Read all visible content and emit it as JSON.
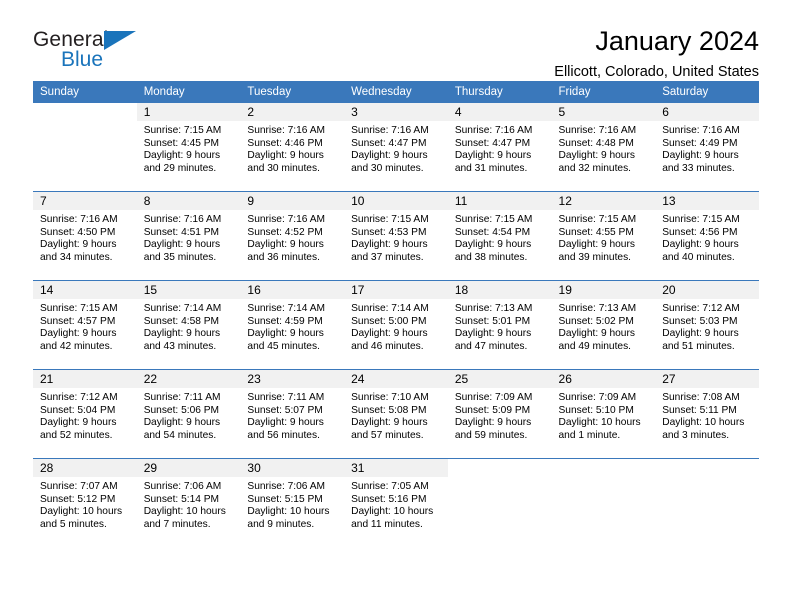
{
  "brand": {
    "name_part1": "General",
    "name_part2": "Blue",
    "triangle_icon": "triangle-icon",
    "accent_color": "#1a74bb"
  },
  "header": {
    "title": "January 2024",
    "subtitle": "Ellicott, Colorado, United States"
  },
  "calendar": {
    "header_bg": "#3a78bb",
    "daynum_bg": "#f1f1f1",
    "weekday_headers": [
      "Sunday",
      "Monday",
      "Tuesday",
      "Wednesday",
      "Thursday",
      "Friday",
      "Saturday"
    ],
    "weeks": [
      [
        {
          "day": "",
          "sunrise": "",
          "sunset": "",
          "daylight_line1": "",
          "daylight_line2": ""
        },
        {
          "day": "1",
          "sunrise": "Sunrise: 7:15 AM",
          "sunset": "Sunset: 4:45 PM",
          "daylight_line1": "Daylight: 9 hours",
          "daylight_line2": "and 29 minutes."
        },
        {
          "day": "2",
          "sunrise": "Sunrise: 7:16 AM",
          "sunset": "Sunset: 4:46 PM",
          "daylight_line1": "Daylight: 9 hours",
          "daylight_line2": "and 30 minutes."
        },
        {
          "day": "3",
          "sunrise": "Sunrise: 7:16 AM",
          "sunset": "Sunset: 4:47 PM",
          "daylight_line1": "Daylight: 9 hours",
          "daylight_line2": "and 30 minutes."
        },
        {
          "day": "4",
          "sunrise": "Sunrise: 7:16 AM",
          "sunset": "Sunset: 4:47 PM",
          "daylight_line1": "Daylight: 9 hours",
          "daylight_line2": "and 31 minutes."
        },
        {
          "day": "5",
          "sunrise": "Sunrise: 7:16 AM",
          "sunset": "Sunset: 4:48 PM",
          "daylight_line1": "Daylight: 9 hours",
          "daylight_line2": "and 32 minutes."
        },
        {
          "day": "6",
          "sunrise": "Sunrise: 7:16 AM",
          "sunset": "Sunset: 4:49 PM",
          "daylight_line1": "Daylight: 9 hours",
          "daylight_line2": "and 33 minutes."
        }
      ],
      [
        {
          "day": "7",
          "sunrise": "Sunrise: 7:16 AM",
          "sunset": "Sunset: 4:50 PM",
          "daylight_line1": "Daylight: 9 hours",
          "daylight_line2": "and 34 minutes."
        },
        {
          "day": "8",
          "sunrise": "Sunrise: 7:16 AM",
          "sunset": "Sunset: 4:51 PM",
          "daylight_line1": "Daylight: 9 hours",
          "daylight_line2": "and 35 minutes."
        },
        {
          "day": "9",
          "sunrise": "Sunrise: 7:16 AM",
          "sunset": "Sunset: 4:52 PM",
          "daylight_line1": "Daylight: 9 hours",
          "daylight_line2": "and 36 minutes."
        },
        {
          "day": "10",
          "sunrise": "Sunrise: 7:15 AM",
          "sunset": "Sunset: 4:53 PM",
          "daylight_line1": "Daylight: 9 hours",
          "daylight_line2": "and 37 minutes."
        },
        {
          "day": "11",
          "sunrise": "Sunrise: 7:15 AM",
          "sunset": "Sunset: 4:54 PM",
          "daylight_line1": "Daylight: 9 hours",
          "daylight_line2": "and 38 minutes."
        },
        {
          "day": "12",
          "sunrise": "Sunrise: 7:15 AM",
          "sunset": "Sunset: 4:55 PM",
          "daylight_line1": "Daylight: 9 hours",
          "daylight_line2": "and 39 minutes."
        },
        {
          "day": "13",
          "sunrise": "Sunrise: 7:15 AM",
          "sunset": "Sunset: 4:56 PM",
          "daylight_line1": "Daylight: 9 hours",
          "daylight_line2": "and 40 minutes."
        }
      ],
      [
        {
          "day": "14",
          "sunrise": "Sunrise: 7:15 AM",
          "sunset": "Sunset: 4:57 PM",
          "daylight_line1": "Daylight: 9 hours",
          "daylight_line2": "and 42 minutes."
        },
        {
          "day": "15",
          "sunrise": "Sunrise: 7:14 AM",
          "sunset": "Sunset: 4:58 PM",
          "daylight_line1": "Daylight: 9 hours",
          "daylight_line2": "and 43 minutes."
        },
        {
          "day": "16",
          "sunrise": "Sunrise: 7:14 AM",
          "sunset": "Sunset: 4:59 PM",
          "daylight_line1": "Daylight: 9 hours",
          "daylight_line2": "and 45 minutes."
        },
        {
          "day": "17",
          "sunrise": "Sunrise: 7:14 AM",
          "sunset": "Sunset: 5:00 PM",
          "daylight_line1": "Daylight: 9 hours",
          "daylight_line2": "and 46 minutes."
        },
        {
          "day": "18",
          "sunrise": "Sunrise: 7:13 AM",
          "sunset": "Sunset: 5:01 PM",
          "daylight_line1": "Daylight: 9 hours",
          "daylight_line2": "and 47 minutes."
        },
        {
          "day": "19",
          "sunrise": "Sunrise: 7:13 AM",
          "sunset": "Sunset: 5:02 PM",
          "daylight_line1": "Daylight: 9 hours",
          "daylight_line2": "and 49 minutes."
        },
        {
          "day": "20",
          "sunrise": "Sunrise: 7:12 AM",
          "sunset": "Sunset: 5:03 PM",
          "daylight_line1": "Daylight: 9 hours",
          "daylight_line2": "and 51 minutes."
        }
      ],
      [
        {
          "day": "21",
          "sunrise": "Sunrise: 7:12 AM",
          "sunset": "Sunset: 5:04 PM",
          "daylight_line1": "Daylight: 9 hours",
          "daylight_line2": "and 52 minutes."
        },
        {
          "day": "22",
          "sunrise": "Sunrise: 7:11 AM",
          "sunset": "Sunset: 5:06 PM",
          "daylight_line1": "Daylight: 9 hours",
          "daylight_line2": "and 54 minutes."
        },
        {
          "day": "23",
          "sunrise": "Sunrise: 7:11 AM",
          "sunset": "Sunset: 5:07 PM",
          "daylight_line1": "Daylight: 9 hours",
          "daylight_line2": "and 56 minutes."
        },
        {
          "day": "24",
          "sunrise": "Sunrise: 7:10 AM",
          "sunset": "Sunset: 5:08 PM",
          "daylight_line1": "Daylight: 9 hours",
          "daylight_line2": "and 57 minutes."
        },
        {
          "day": "25",
          "sunrise": "Sunrise: 7:09 AM",
          "sunset": "Sunset: 5:09 PM",
          "daylight_line1": "Daylight: 9 hours",
          "daylight_line2": "and 59 minutes."
        },
        {
          "day": "26",
          "sunrise": "Sunrise: 7:09 AM",
          "sunset": "Sunset: 5:10 PM",
          "daylight_line1": "Daylight: 10 hours",
          "daylight_line2": "and 1 minute."
        },
        {
          "day": "27",
          "sunrise": "Sunrise: 7:08 AM",
          "sunset": "Sunset: 5:11 PM",
          "daylight_line1": "Daylight: 10 hours",
          "daylight_line2": "and 3 minutes."
        }
      ],
      [
        {
          "day": "28",
          "sunrise": "Sunrise: 7:07 AM",
          "sunset": "Sunset: 5:12 PM",
          "daylight_line1": "Daylight: 10 hours",
          "daylight_line2": "and 5 minutes."
        },
        {
          "day": "29",
          "sunrise": "Sunrise: 7:06 AM",
          "sunset": "Sunset: 5:14 PM",
          "daylight_line1": "Daylight: 10 hours",
          "daylight_line2": "and 7 minutes."
        },
        {
          "day": "30",
          "sunrise": "Sunrise: 7:06 AM",
          "sunset": "Sunset: 5:15 PM",
          "daylight_line1": "Daylight: 10 hours",
          "daylight_line2": "and 9 minutes."
        },
        {
          "day": "31",
          "sunrise": "Sunrise: 7:05 AM",
          "sunset": "Sunset: 5:16 PM",
          "daylight_line1": "Daylight: 10 hours",
          "daylight_line2": "and 11 minutes."
        },
        {
          "day": "",
          "sunrise": "",
          "sunset": "",
          "daylight_line1": "",
          "daylight_line2": ""
        },
        {
          "day": "",
          "sunrise": "",
          "sunset": "",
          "daylight_line1": "",
          "daylight_line2": ""
        },
        {
          "day": "",
          "sunrise": "",
          "sunset": "",
          "daylight_line1": "",
          "daylight_line2": ""
        }
      ]
    ]
  }
}
